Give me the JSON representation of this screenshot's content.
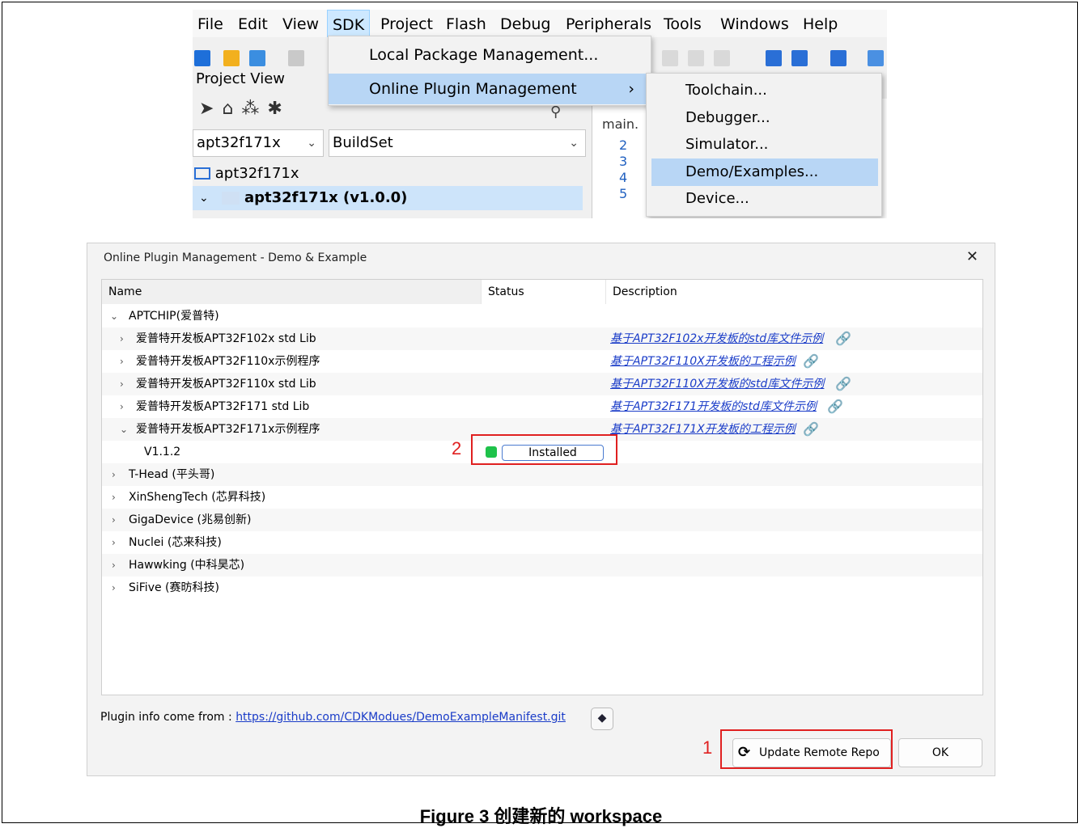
{
  "ide": {
    "menu": [
      "File",
      "Edit",
      "View",
      "SDK",
      "Project",
      "Flash",
      "Debug",
      "Peripherals",
      "Tools",
      "Windows",
      "Help"
    ],
    "project_view_title": "Project View",
    "combo_project": "apt32f171x",
    "combo_buildset": "BuildSet",
    "tree_workspace": "apt32f171x",
    "tree_project": "apt32f171x (v1.0.0)",
    "editor_tab": "main.",
    "gutter_numbers": [
      "2",
      "3",
      "4",
      "5"
    ],
    "sdk_menu": [
      "Local Package Management...",
      "Online Plugin Management"
    ],
    "submenu": [
      "Toolchain...",
      "Debugger...",
      "Simulator...",
      "Demo/Examples...",
      "Device..."
    ]
  },
  "dialog": {
    "title": "Online Plugin Management - Demo & Example",
    "columns": [
      "Name",
      "Status",
      "Description"
    ],
    "rows": [
      {
        "label": "APTCHIP(爱普特)",
        "desc": ""
      },
      {
        "label": "爱普特开发板APT32F102x std Lib",
        "desc": "基于APT32F102x开发板的std库文件示例"
      },
      {
        "label": "爱普特开发板APT32F110x示例程序",
        "desc": "基于APT32F110X开发板的工程示例"
      },
      {
        "label": "爱普特开发板APT32F110x std Lib",
        "desc": "基于APT32F110X开发板的std库文件示例"
      },
      {
        "label": "爱普特开发板APT32F171 std Lib",
        "desc": "基于APT32F171开发板的std库文件示例"
      },
      {
        "label": "爱普特开发板APT32F171x示例程序",
        "desc": "基于APT32F171X开发板的工程示例"
      },
      {
        "label": "V1.1.2",
        "desc": "",
        "status": "Installed"
      },
      {
        "label": "T-Head (平头哥)",
        "desc": ""
      },
      {
        "label": "XinShengTech (芯昇科技)",
        "desc": ""
      },
      {
        "label": "GigaDevice (兆易创新)",
        "desc": ""
      },
      {
        "label": "Nuclei (芯来科技)",
        "desc": ""
      },
      {
        "label": "Hawwking (中科昊芯)",
        "desc": ""
      },
      {
        "label": "SiFive (赛昉科技)",
        "desc": ""
      }
    ],
    "footer_label": "Plugin info come from :",
    "footer_url": "https://github.com/CDKModues/DemoExampleManifest.git",
    "update_button": "Update Remote Repo",
    "ok_button": "OK"
  },
  "annotations": {
    "one": "1",
    "two": "2"
  },
  "caption": "Figure 3  创建新的 workspace",
  "colors": {
    "highlight": "#b8d6f5",
    "link": "#1a3cc8",
    "annotation": "#e02020",
    "installed": "#1ec24a"
  }
}
